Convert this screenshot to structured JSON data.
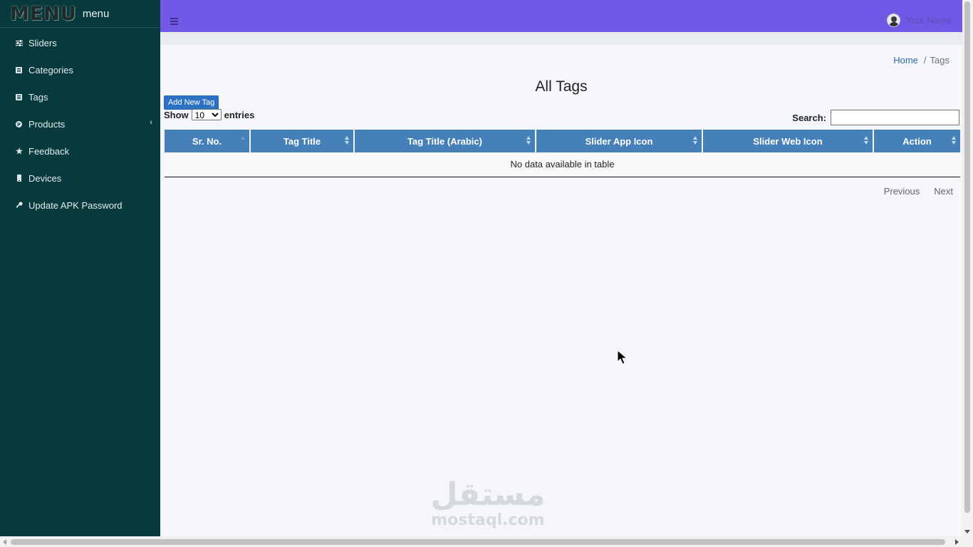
{
  "sidebar": {
    "brand_logo": "MENU",
    "brand_text": "menu",
    "items": [
      {
        "label": "Sliders",
        "icon": "sliders-icon"
      },
      {
        "label": "Categories",
        "icon": "list-icon"
      },
      {
        "label": "Tags",
        "icon": "list-icon"
      },
      {
        "label": "Products",
        "icon": "product-hunt-icon",
        "has_submenu": true
      },
      {
        "label": "Feedback",
        "icon": "star-icon"
      },
      {
        "label": "Devices",
        "icon": "mobile-icon"
      },
      {
        "label": "Update APK Password",
        "icon": "key-icon"
      }
    ]
  },
  "topbar": {
    "user_name": "Your Name",
    "bg_color": "#7258e6"
  },
  "breadcrumb": {
    "home": "Home",
    "separator": "/",
    "current": "Tags"
  },
  "page": {
    "title": "All Tags",
    "add_button": "Add New Tag"
  },
  "table_controls": {
    "show_label": "Show",
    "entries_label": "entries",
    "page_size": "10",
    "page_size_options": [
      "10"
    ],
    "search_label": "Search:",
    "search_value": ""
  },
  "table": {
    "columns": [
      "Sr. No.",
      "Tag Title",
      "Tag Title (Arabic)",
      "Slider App Icon",
      "Slider Web Icon",
      "Action"
    ],
    "empty_message": "No data available in table",
    "header_color": "#4580b8"
  },
  "pagination": {
    "previous": "Previous",
    "next": "Next"
  },
  "watermark": {
    "arabic": "مستقل",
    "latin": "mostaql.com"
  }
}
